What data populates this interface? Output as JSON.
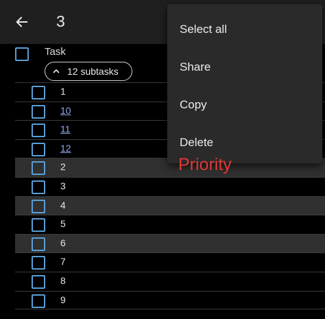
{
  "app_bar": {
    "title": "3"
  },
  "header": {
    "label": "Task",
    "chip_label": "12 subtasks"
  },
  "rows": [
    {
      "label": "1"
    },
    {
      "label": "10"
    },
    {
      "label": "11"
    },
    {
      "label": "12"
    },
    {
      "label": "2"
    },
    {
      "label": "3"
    },
    {
      "label": "4"
    },
    {
      "label": "5"
    },
    {
      "label": "6"
    },
    {
      "label": "7"
    },
    {
      "label": "8"
    },
    {
      "label": "9"
    }
  ],
  "menu": {
    "items": [
      {
        "label": "Select all"
      },
      {
        "label": "Share"
      },
      {
        "label": "Copy"
      },
      {
        "label": "Delete"
      }
    ]
  },
  "overlay": {
    "priority_text": "Priority"
  },
  "colors": {
    "checkbox": "#5b9fd6",
    "link": "#8fa8ea",
    "priority": "#e03a35",
    "highlight_row": "#303030",
    "app_bar": "#1f1f1f",
    "menu_bg": "#2a2a2a"
  }
}
